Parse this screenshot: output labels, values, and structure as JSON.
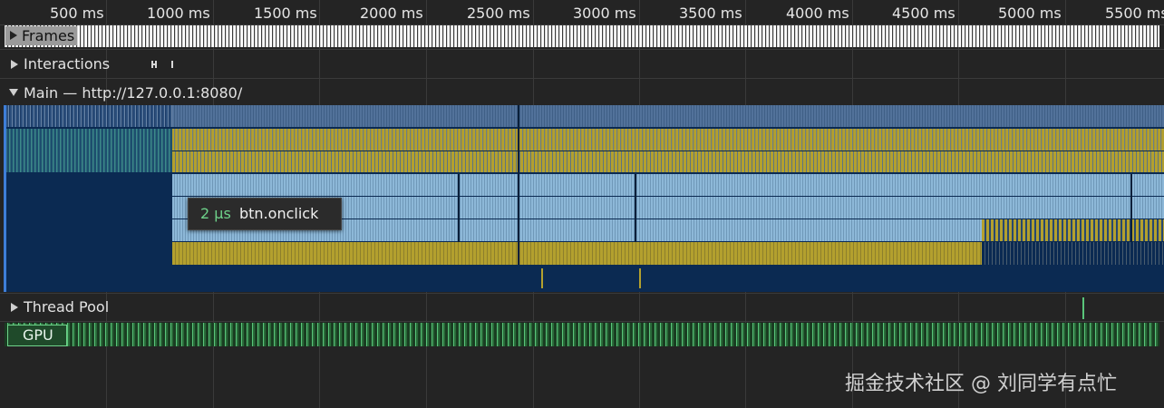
{
  "ruler": {
    "ticks": [
      "500 ms",
      "1000 ms",
      "1500 ms",
      "2000 ms",
      "2500 ms",
      "3000 ms",
      "3500 ms",
      "4000 ms",
      "4500 ms",
      "5000 ms",
      "5500 ms"
    ]
  },
  "tracks": {
    "frames": "Frames",
    "interactions": "Interactions",
    "main": "Main — http://127.0.0.1:8080/",
    "thread_pool": "Thread Pool",
    "gpu": "GPU"
  },
  "tooltip": {
    "duration": "2 µs",
    "function": "btn.onclick"
  },
  "colors": {
    "main_background": "#0b2a52",
    "task_gray": "#4a6a8e",
    "script_yellow": "#b3a02e",
    "light_blue": "#8db8d8",
    "gpu_green": "#59c57a",
    "selection_blue": "#3e7ed8"
  },
  "icons": {
    "expand_collapsed": "triangle-right-icon",
    "expand_open": "triangle-down-icon"
  },
  "watermark": "掘金技术社区 @ 刘同学有点忙"
}
